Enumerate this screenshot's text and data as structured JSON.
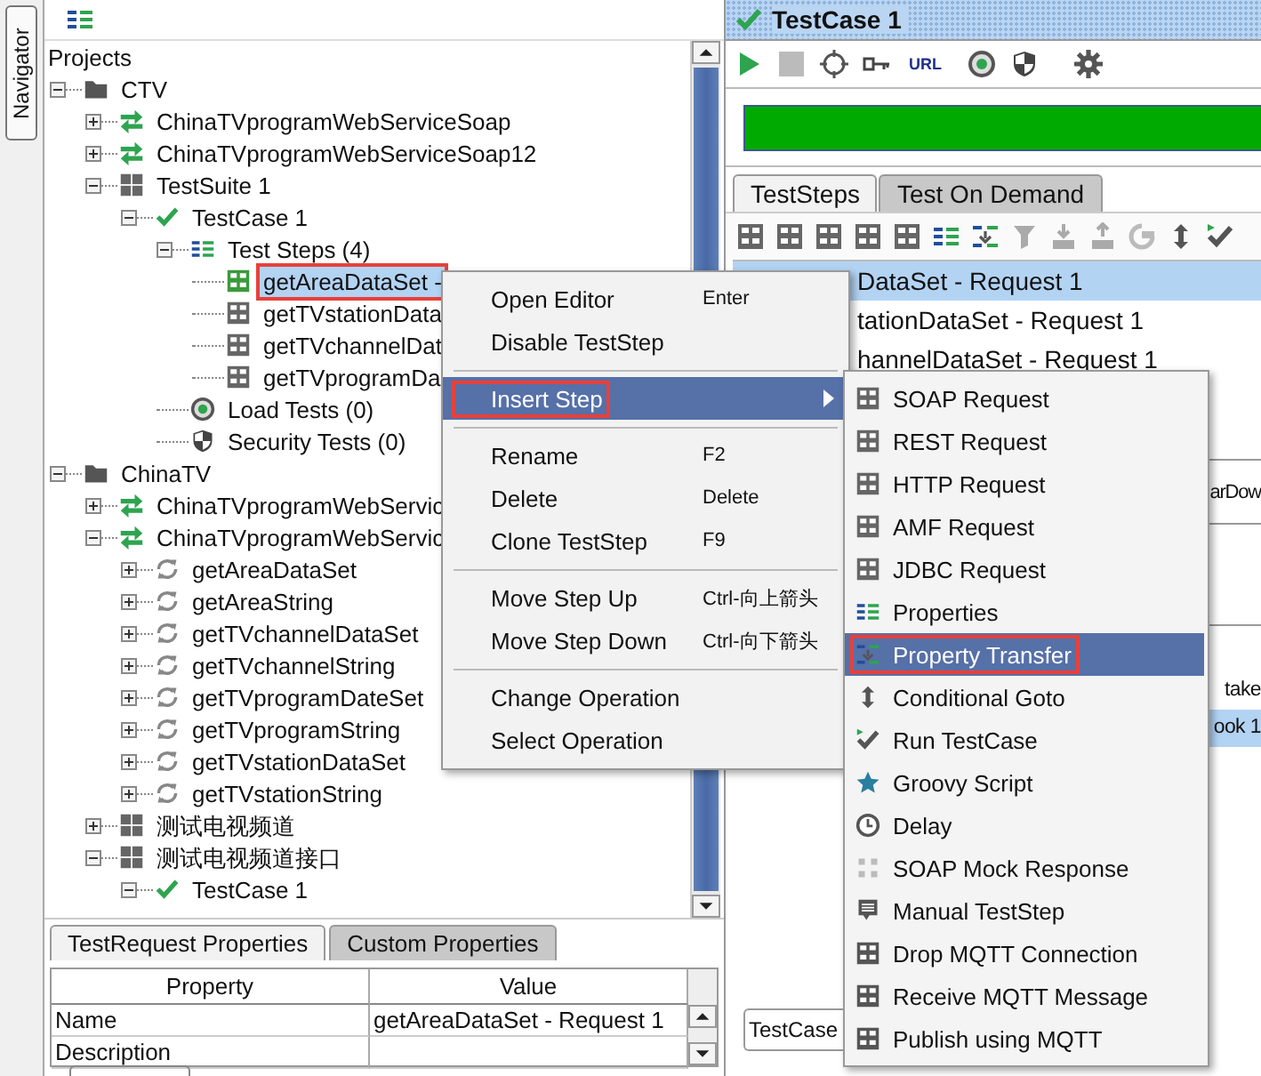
{
  "navigator_tab": "Navigator",
  "tree_title": "Projects",
  "tree": [
    {
      "label": "CTV",
      "kind": "folder",
      "expanded": true,
      "selected": false,
      "children": [
        {
          "label": "ChinaTVprogramWebServiceSoap",
          "kind": "interface",
          "expanded": false,
          "selected": false
        },
        {
          "label": "ChinaTVprogramWebServiceSoap12",
          "kind": "interface",
          "expanded": false,
          "selected": false
        },
        {
          "label": "TestSuite 1",
          "kind": "suite",
          "expanded": true,
          "selected": false,
          "children": [
            {
              "label": "TestCase 1",
              "kind": "testcase",
              "expanded": true,
              "selected": false,
              "children": [
                {
                  "label": "Test Steps (4)",
                  "kind": "steps",
                  "expanded": true,
                  "selected": false,
                  "children": [
                    {
                      "label": "getAreaDataSet -",
                      "kind": "soap",
                      "selected": true,
                      "annotated": true
                    },
                    {
                      "label": "getTVstationData",
                      "kind": "soap",
                      "selected": false,
                      "annotated": false
                    },
                    {
                      "label": "getTVchannelDat",
                      "kind": "soap",
                      "selected": false,
                      "annotated": false
                    },
                    {
                      "label": "getTVprogramDa",
                      "kind": "soap",
                      "selected": false,
                      "annotated": false
                    }
                  ]
                },
                {
                  "label": "Load Tests (0)",
                  "kind": "load",
                  "selected": false
                },
                {
                  "label": "Security Tests (0)",
                  "kind": "security",
                  "selected": false
                }
              ]
            }
          ]
        }
      ]
    },
    {
      "label": "ChinaTV",
      "kind": "folder",
      "expanded": true,
      "selected": false,
      "children": [
        {
          "label": "ChinaTVprogramWebServic",
          "kind": "interface",
          "expanded": false,
          "selected": false
        },
        {
          "label": "ChinaTVprogramWebServic",
          "kind": "interface",
          "expanded": true,
          "selected": false,
          "children": [
            {
              "label": "getAreaDataSet",
              "kind": "operation",
              "expanded": false,
              "selected": false
            },
            {
              "label": "getAreaString",
              "kind": "operation",
              "expanded": false,
              "selected": false
            },
            {
              "label": "getTVchannelDataSet",
              "kind": "operation",
              "expanded": false,
              "selected": false
            },
            {
              "label": "getTVchannelString",
              "kind": "operation",
              "expanded": false,
              "selected": false
            },
            {
              "label": "getTVprogramDateSet",
              "kind": "operation",
              "expanded": false,
              "selected": false
            },
            {
              "label": "getTVprogramString",
              "kind": "operation",
              "expanded": false,
              "selected": false
            },
            {
              "label": "getTVstationDataSet",
              "kind": "operation",
              "expanded": false,
              "selected": false
            },
            {
              "label": "getTVstationString",
              "kind": "operation",
              "expanded": false,
              "selected": false
            }
          ]
        },
        {
          "label": "测试电视频道",
          "kind": "suite",
          "expanded": false,
          "selected": false
        },
        {
          "label": "测试电视频道接口",
          "kind": "suite",
          "expanded": true,
          "selected": false,
          "children": [
            {
              "label": "TestCase 1",
              "kind": "testcase",
              "expanded": true,
              "selected": false
            }
          ]
        }
      ]
    }
  ],
  "properties": {
    "tabs": [
      {
        "label": "TestRequest Properties",
        "selected": true
      },
      {
        "label": "Custom Properties",
        "selected": false
      }
    ],
    "columns": [
      "Property",
      "Value"
    ],
    "rows": [
      {
        "property": "Name",
        "value": "getAreaDataSet - Request 1"
      },
      {
        "property": "Description"
      }
    ]
  },
  "editor": {
    "title": "TestCase 1",
    "url_button": "URL",
    "progress": {
      "level": 1
    },
    "tabs": [
      {
        "label": "TestSteps",
        "selected": true
      },
      {
        "label": "Test On Demand",
        "selected": false
      }
    ],
    "steps": [
      {
        "label": "DataSet - Request 1",
        "selected": true
      },
      {
        "label": "tationDataSet - Request 1",
        "selected": false
      },
      {
        "label": "hannelDataSet - Request 1",
        "selected": false
      }
    ],
    "teardown_fragment": "arDow",
    "log_lines": [
      {
        "text": "take",
        "selected": false
      },
      {
        "text": "ook 1",
        "selected": true
      }
    ],
    "testcase_field": "TestCase"
  },
  "context_menu": [
    {
      "kind": "item",
      "label": "Open Editor",
      "shortcut": "Enter",
      "selected": false,
      "annotated": false,
      "submenu": false
    },
    {
      "kind": "item",
      "label": "Disable TestStep",
      "selected": false,
      "annotated": false,
      "submenu": false
    },
    {
      "kind": "separator"
    },
    {
      "kind": "item",
      "label": "Insert Step",
      "selected": true,
      "annotated": true,
      "submenu": true
    },
    {
      "kind": "separator"
    },
    {
      "kind": "item",
      "label": "Rename",
      "shortcut": "F2",
      "selected": false,
      "annotated": false,
      "submenu": false
    },
    {
      "kind": "item",
      "label": "Delete",
      "shortcut": "Delete",
      "selected": false,
      "annotated": false,
      "submenu": false
    },
    {
      "kind": "item",
      "label": "Clone TestStep",
      "shortcut": "F9",
      "selected": false,
      "annotated": false,
      "submenu": false
    },
    {
      "kind": "separator"
    },
    {
      "kind": "item",
      "label": "Move Step Up",
      "shortcut": "Ctrl-向上箭头",
      "selected": false,
      "annotated": false,
      "submenu": false
    },
    {
      "kind": "item",
      "label": "Move Step Down",
      "shortcut": "Ctrl-向下箭头",
      "selected": false,
      "annotated": false,
      "submenu": false
    },
    {
      "kind": "separator"
    },
    {
      "kind": "item",
      "label": "Change Operation",
      "selected": false,
      "annotated": false,
      "submenu": false
    },
    {
      "kind": "item",
      "label": "Select Operation",
      "selected": false,
      "annotated": false,
      "submenu": false
    }
  ],
  "submenu_items": [
    {
      "label": "SOAP Request",
      "kind": "soap",
      "selected": false,
      "annotated": false
    },
    {
      "label": "REST Request",
      "kind": "tile",
      "selected": false,
      "annotated": false
    },
    {
      "label": "HTTP Request",
      "kind": "tile",
      "selected": false,
      "annotated": false
    },
    {
      "label": "AMF Request",
      "kind": "tile",
      "selected": false,
      "annotated": false
    },
    {
      "label": "JDBC Request",
      "kind": "tile",
      "selected": false,
      "annotated": false
    },
    {
      "label": "Properties",
      "kind": "steps",
      "selected": false,
      "annotated": false
    },
    {
      "label": "Property Transfer",
      "kind": "transfer",
      "selected": true,
      "annotated": true
    },
    {
      "label": "Conditional Goto",
      "kind": "updown",
      "selected": false,
      "annotated": false
    },
    {
      "label": "Run TestCase",
      "kind": "runcase",
      "selected": false,
      "annotated": false
    },
    {
      "label": "Groovy Script",
      "kind": "star",
      "selected": false,
      "annotated": false
    },
    {
      "label": "Delay",
      "kind": "clock",
      "selected": false,
      "annotated": false
    },
    {
      "label": "SOAP Mock Response",
      "kind": "mock",
      "selected": false,
      "annotated": false
    },
    {
      "label": "Manual TestStep",
      "kind": "manual",
      "selected": false,
      "annotated": false
    },
    {
      "label": "Drop MQTT Connection",
      "kind": "mqtt",
      "selected": false,
      "annotated": false
    },
    {
      "label": "Receive MQTT Message",
      "kind": "mqtt",
      "selected": false,
      "annotated": false
    },
    {
      "label": "Publish using MQTT",
      "kind": "mqtt",
      "selected": false,
      "annotated": false
    }
  ]
}
